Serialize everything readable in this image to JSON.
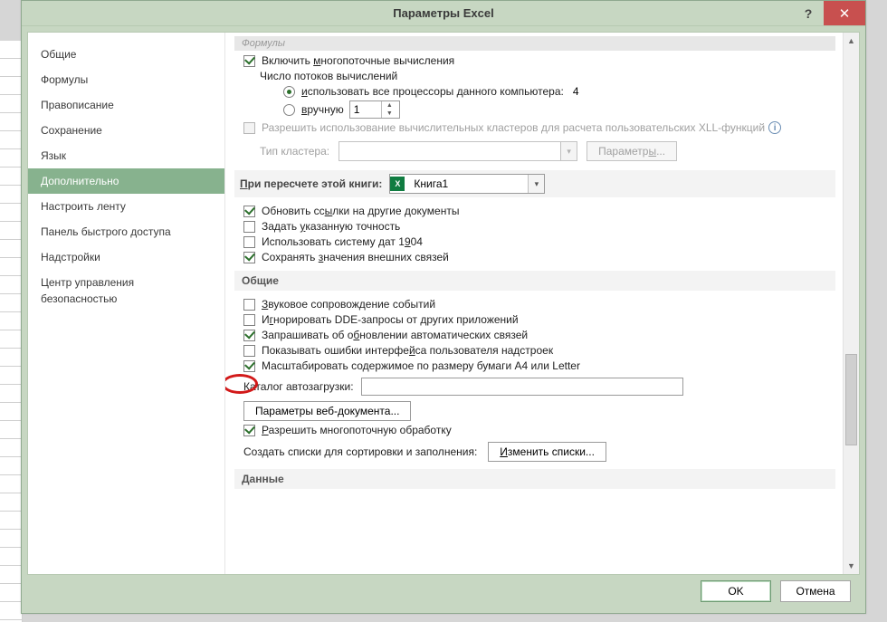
{
  "window": {
    "title": "Параметры Excel"
  },
  "sidebar": {
    "items": [
      {
        "label": "Общие"
      },
      {
        "label": "Формулы"
      },
      {
        "label": "Правописание"
      },
      {
        "label": "Сохранение"
      },
      {
        "label": "Язык"
      },
      {
        "label": "Дополнительно"
      },
      {
        "label": "Настроить ленту"
      },
      {
        "label": "Панель быстрого доступа"
      },
      {
        "label": "Надстройки"
      },
      {
        "label": "Центр управления безопасностью"
      }
    ],
    "selected_index": 5
  },
  "sections": {
    "formuly_partial_label": "Формулы",
    "multithread_calc": "Включить многопоточные вычисления",
    "threads_label": "Число потоков вычислений",
    "use_all_processors": "использовать все процессоры данного компьютера:",
    "processor_count": "4",
    "manual": "вручную",
    "manual_value": "1",
    "allow_xll": "Разрешить использование вычислительных кластеров для расчета пользовательских XLL-функций",
    "cluster_type": "Тип кластера:",
    "cluster_params_btn": "Параметры...",
    "recalc_header": "При пересчете этой книги:",
    "workbook_name": "Книга1",
    "update_links": "Обновить ссылки на другие документы",
    "set_precision": "Задать указанную точность",
    "use_1904": "Использовать систему дат 1904",
    "keep_external": "Сохранять значения внешних связей",
    "general_header": "Общие",
    "sound_events": "Звуковое сопровождение событий",
    "ignore_dde": "Игнорировать DDE-запросы от других приложений",
    "ask_auto_links": "Запрашивать об обновлении автоматических связей",
    "show_addin_errors": "Показывать ошибки интерфейса пользователя надстроек",
    "scale_a4": "Масштабировать содержимое по размеру бумаги A4 или Letter",
    "startup_dir": "Каталог автозагрузки:",
    "web_params_btn": "Параметры веб-документа...",
    "allow_multi": "Разрешить многопоточную обработку",
    "create_lists": "Создать списки для сортировки и заполнения:",
    "edit_lists_btn": "Изменить списки...",
    "data_header": "Данные"
  },
  "buttons": {
    "ok": "OK",
    "cancel": "Отмена"
  }
}
